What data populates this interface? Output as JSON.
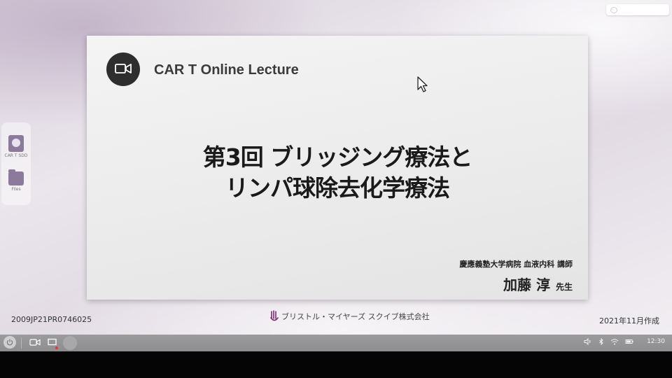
{
  "slide": {
    "lecture_title": "CAR T Online Lecture",
    "title_line1": "第3回 ブリッジング療法と",
    "title_line2": "リンパ球除去化学療法",
    "affiliation": "慶應義塾大学病院 血液内科 講師",
    "presenter": "加藤 淳",
    "honorific": "先生"
  },
  "footer": {
    "doc_code": "2009JP21PR0746025",
    "company": "ブリストル・マイヤーズ スクイブ株式会社",
    "created": "2021年11月作成"
  },
  "dock": {
    "items": [
      {
        "label": "CAR T SDD",
        "icon": "app-icon"
      },
      {
        "label": "Files",
        "icon": "folder-icon"
      }
    ]
  },
  "taskbar": {
    "clock": "12:30",
    "icons": [
      "power-icon",
      "video-icon",
      "screen-icon",
      "volume-icon",
      "bluetooth-icon",
      "wifi-icon",
      "battery-icon"
    ]
  }
}
